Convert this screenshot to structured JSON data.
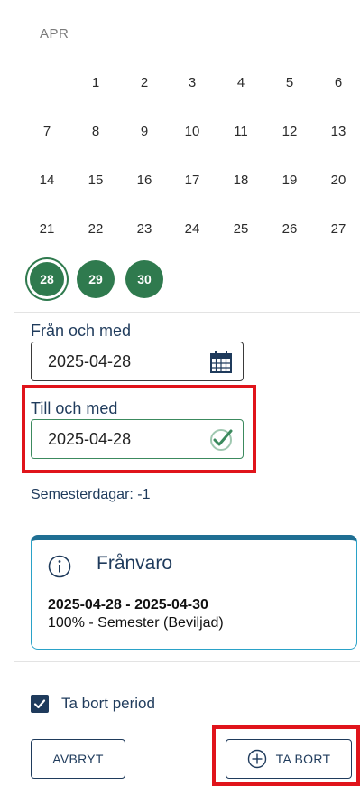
{
  "calendar": {
    "month_label": "APR",
    "weeks": [
      [
        "",
        "1",
        "2",
        "3",
        "4",
        "5",
        "6"
      ],
      [
        "7",
        "8",
        "9",
        "10",
        "11",
        "12",
        "13"
      ],
      [
        "14",
        "15",
        "16",
        "17",
        "18",
        "19",
        "20"
      ],
      [
        "21",
        "22",
        "23",
        "24",
        "25",
        "26",
        "27"
      ]
    ],
    "selected_days": [
      "28",
      "29",
      "30"
    ],
    "today": "28",
    "accent_color": "#2f7a4e"
  },
  "form": {
    "from_label": "Från och med",
    "from_value": "2025-04-28",
    "from_icon": "calendar-icon",
    "to_label": "Till och med",
    "to_value": "2025-04-28",
    "to_icon": "check-valid-icon",
    "vacation_days_text": "Semesterdagar: -1"
  },
  "absence_card": {
    "icon": "info-icon",
    "title": "Frånvaro",
    "dates": "2025-04-28 - 2025-04-30",
    "detail": "100% - Semester (Beviljad)"
  },
  "remove_period": {
    "checked": true,
    "label": "Ta bort period"
  },
  "buttons": {
    "cancel_label": "AVBRYT",
    "remove_label": "TA BORT",
    "remove_icon": "plus-circle-icon"
  },
  "colors": {
    "highlight": "#e0141b",
    "text_navy": "#1f3b5c",
    "card_border": "#2aa2c8"
  }
}
